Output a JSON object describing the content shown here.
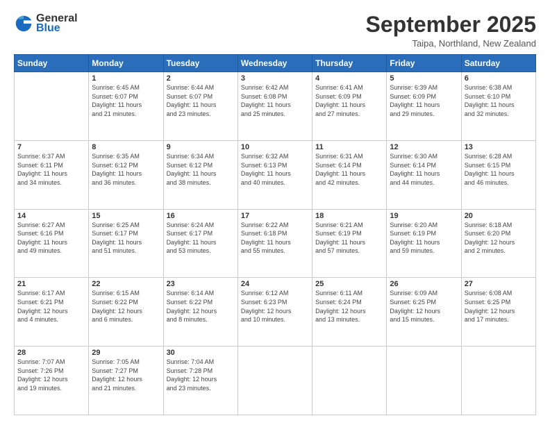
{
  "logo": {
    "general": "General",
    "blue": "Blue"
  },
  "header": {
    "title": "September 2025",
    "subtitle": "Taipa, Northland, New Zealand"
  },
  "days_of_week": [
    "Sunday",
    "Monday",
    "Tuesday",
    "Wednesday",
    "Thursday",
    "Friday",
    "Saturday"
  ],
  "weeks": [
    [
      {
        "day": "",
        "info": ""
      },
      {
        "day": "1",
        "info": "Sunrise: 6:45 AM\nSunset: 6:07 PM\nDaylight: 11 hours\nand 21 minutes."
      },
      {
        "day": "2",
        "info": "Sunrise: 6:44 AM\nSunset: 6:07 PM\nDaylight: 11 hours\nand 23 minutes."
      },
      {
        "day": "3",
        "info": "Sunrise: 6:42 AM\nSunset: 6:08 PM\nDaylight: 11 hours\nand 25 minutes."
      },
      {
        "day": "4",
        "info": "Sunrise: 6:41 AM\nSunset: 6:09 PM\nDaylight: 11 hours\nand 27 minutes."
      },
      {
        "day": "5",
        "info": "Sunrise: 6:39 AM\nSunset: 6:09 PM\nDaylight: 11 hours\nand 29 minutes."
      },
      {
        "day": "6",
        "info": "Sunrise: 6:38 AM\nSunset: 6:10 PM\nDaylight: 11 hours\nand 32 minutes."
      }
    ],
    [
      {
        "day": "7",
        "info": "Sunrise: 6:37 AM\nSunset: 6:11 PM\nDaylight: 11 hours\nand 34 minutes."
      },
      {
        "day": "8",
        "info": "Sunrise: 6:35 AM\nSunset: 6:12 PM\nDaylight: 11 hours\nand 36 minutes."
      },
      {
        "day": "9",
        "info": "Sunrise: 6:34 AM\nSunset: 6:12 PM\nDaylight: 11 hours\nand 38 minutes."
      },
      {
        "day": "10",
        "info": "Sunrise: 6:32 AM\nSunset: 6:13 PM\nDaylight: 11 hours\nand 40 minutes."
      },
      {
        "day": "11",
        "info": "Sunrise: 6:31 AM\nSunset: 6:14 PM\nDaylight: 11 hours\nand 42 minutes."
      },
      {
        "day": "12",
        "info": "Sunrise: 6:30 AM\nSunset: 6:14 PM\nDaylight: 11 hours\nand 44 minutes."
      },
      {
        "day": "13",
        "info": "Sunrise: 6:28 AM\nSunset: 6:15 PM\nDaylight: 11 hours\nand 46 minutes."
      }
    ],
    [
      {
        "day": "14",
        "info": "Sunrise: 6:27 AM\nSunset: 6:16 PM\nDaylight: 11 hours\nand 49 minutes."
      },
      {
        "day": "15",
        "info": "Sunrise: 6:25 AM\nSunset: 6:17 PM\nDaylight: 11 hours\nand 51 minutes."
      },
      {
        "day": "16",
        "info": "Sunrise: 6:24 AM\nSunset: 6:17 PM\nDaylight: 11 hours\nand 53 minutes."
      },
      {
        "day": "17",
        "info": "Sunrise: 6:22 AM\nSunset: 6:18 PM\nDaylight: 11 hours\nand 55 minutes."
      },
      {
        "day": "18",
        "info": "Sunrise: 6:21 AM\nSunset: 6:19 PM\nDaylight: 11 hours\nand 57 minutes."
      },
      {
        "day": "19",
        "info": "Sunrise: 6:20 AM\nSunset: 6:19 PM\nDaylight: 11 hours\nand 59 minutes."
      },
      {
        "day": "20",
        "info": "Sunrise: 6:18 AM\nSunset: 6:20 PM\nDaylight: 12 hours\nand 2 minutes."
      }
    ],
    [
      {
        "day": "21",
        "info": "Sunrise: 6:17 AM\nSunset: 6:21 PM\nDaylight: 12 hours\nand 4 minutes."
      },
      {
        "day": "22",
        "info": "Sunrise: 6:15 AM\nSunset: 6:22 PM\nDaylight: 12 hours\nand 6 minutes."
      },
      {
        "day": "23",
        "info": "Sunrise: 6:14 AM\nSunset: 6:22 PM\nDaylight: 12 hours\nand 8 minutes."
      },
      {
        "day": "24",
        "info": "Sunrise: 6:12 AM\nSunset: 6:23 PM\nDaylight: 12 hours\nand 10 minutes."
      },
      {
        "day": "25",
        "info": "Sunrise: 6:11 AM\nSunset: 6:24 PM\nDaylight: 12 hours\nand 13 minutes."
      },
      {
        "day": "26",
        "info": "Sunrise: 6:09 AM\nSunset: 6:25 PM\nDaylight: 12 hours\nand 15 minutes."
      },
      {
        "day": "27",
        "info": "Sunrise: 6:08 AM\nSunset: 6:25 PM\nDaylight: 12 hours\nand 17 minutes."
      }
    ],
    [
      {
        "day": "28",
        "info": "Sunrise: 7:07 AM\nSunset: 7:26 PM\nDaylight: 12 hours\nand 19 minutes."
      },
      {
        "day": "29",
        "info": "Sunrise: 7:05 AM\nSunset: 7:27 PM\nDaylight: 12 hours\nand 21 minutes."
      },
      {
        "day": "30",
        "info": "Sunrise: 7:04 AM\nSunset: 7:28 PM\nDaylight: 12 hours\nand 23 minutes."
      },
      {
        "day": "",
        "info": ""
      },
      {
        "day": "",
        "info": ""
      },
      {
        "day": "",
        "info": ""
      },
      {
        "day": "",
        "info": ""
      }
    ]
  ]
}
